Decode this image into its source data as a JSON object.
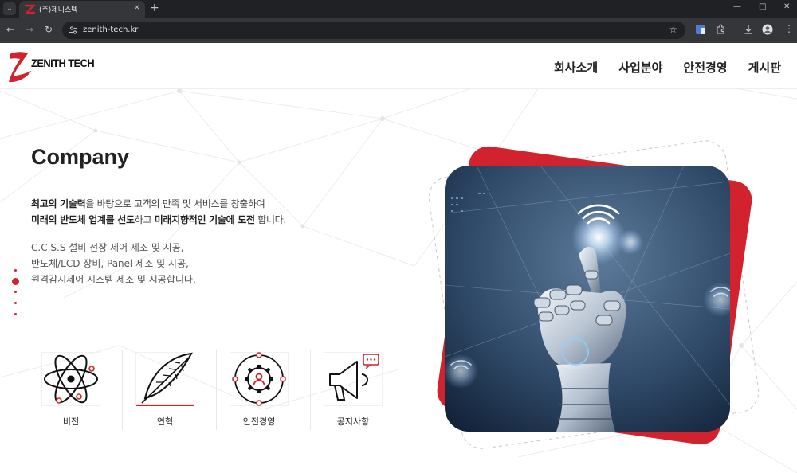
{
  "browser": {
    "tab_title": "(주)제니스텍",
    "tab_menu_icon": "chevron-down-icon",
    "tab_close_icon": "×",
    "new_tab_icon": "+",
    "window_controls": {
      "minimize": "—",
      "maximize": "□",
      "close": "✕"
    },
    "url": "zenith-tech.kr",
    "back_icon": "←",
    "forward_icon": "→",
    "reload_icon": "↻",
    "star_icon": "☆"
  },
  "site": {
    "logo_text": "ZENITH TECH",
    "nav": [
      "회사소개",
      "사업분야",
      "안전경영",
      "게시판"
    ],
    "hero_title": "Company",
    "desc": {
      "l1_b1": "최고의 기술력",
      "l1_t1": "을 바탕으로 고객의 만족 및 서비스를 창출하여",
      "l2_b1": "미래의 반도체 업계를 선도",
      "l2_t1": "하고 ",
      "l2_b2": "미래지향적인 기술에 도전",
      "l2_t2": " 합니다."
    },
    "services": [
      "C.C.S.S 설비 전장 제어 제조 및 시공,",
      "반도체/LCD 장비, Panel 제조 및 시공,",
      "원격감시제어 시스템 제조 및 시공합니다."
    ],
    "quick_links": [
      {
        "label": "비전",
        "icon": "atom-icon"
      },
      {
        "label": "연혁",
        "icon": "feather-icon"
      },
      {
        "label": "안전경영",
        "icon": "safety-gear-icon"
      },
      {
        "label": "공지사항",
        "icon": "megaphone-icon"
      }
    ]
  },
  "colors": {
    "brand_red": "#d2222d",
    "text_dark": "#222222"
  }
}
